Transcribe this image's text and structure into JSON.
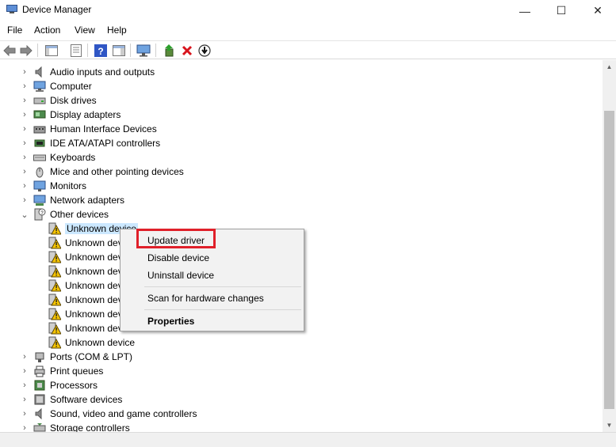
{
  "window": {
    "title": "Device Manager",
    "controls": {
      "minimize": "—",
      "maximize": "☐",
      "close": "✕"
    }
  },
  "menu": [
    "File",
    "Action",
    "View",
    "Help"
  ],
  "toolbar": {
    "icons": [
      "back-arrow-icon",
      "forward-arrow-icon",
      "console-tree-icon",
      "properties-icon",
      "help-icon",
      "action-pane-icon",
      "monitor-scan-icon",
      "update-driver-icon",
      "uninstall-icon",
      "download-icon"
    ]
  },
  "tree": {
    "categories_top": [
      {
        "label": "Audio inputs and outputs",
        "icon": "speaker-icon"
      },
      {
        "label": "Computer",
        "icon": "computer-icon"
      },
      {
        "label": "Disk drives",
        "icon": "disk-icon"
      },
      {
        "label": "Display adapters",
        "icon": "display-adapter-icon"
      },
      {
        "label": "Human Interface Devices",
        "icon": "hid-icon"
      },
      {
        "label": "IDE ATA/ATAPI controllers",
        "icon": "ide-icon"
      },
      {
        "label": "Keyboards",
        "icon": "keyboard-icon"
      },
      {
        "label": "Mice and other pointing devices",
        "icon": "mouse-icon"
      },
      {
        "label": "Monitors",
        "icon": "monitor-icon"
      },
      {
        "label": "Network adapters",
        "icon": "network-icon"
      }
    ],
    "expanded": {
      "label": "Other devices",
      "icon": "other-devices-icon"
    },
    "children": [
      "Unknown device",
      "Unknown dev",
      "Unknown dev",
      "Unknown dev",
      "Unknown dev",
      "Unknown dev",
      "Unknown dev",
      "Unknown dev",
      "Unknown device"
    ],
    "categories_bottom": [
      {
        "label": "Ports (COM & LPT)",
        "icon": "port-icon"
      },
      {
        "label": "Print queues",
        "icon": "printer-icon"
      },
      {
        "label": "Processors",
        "icon": "processor-icon"
      },
      {
        "label": "Software devices",
        "icon": "software-icon"
      },
      {
        "label": "Sound, video and game controllers",
        "icon": "sound-icon"
      },
      {
        "label": "Storage controllers",
        "icon": "storage-icon"
      }
    ]
  },
  "context_menu": {
    "update": "Update driver",
    "disable": "Disable device",
    "uninstall": "Uninstall device",
    "scan": "Scan for hardware changes",
    "properties": "Properties"
  },
  "colors": {
    "highlight": "#e0202a",
    "selection": "#cce8ff",
    "warning": "#f5c400"
  }
}
